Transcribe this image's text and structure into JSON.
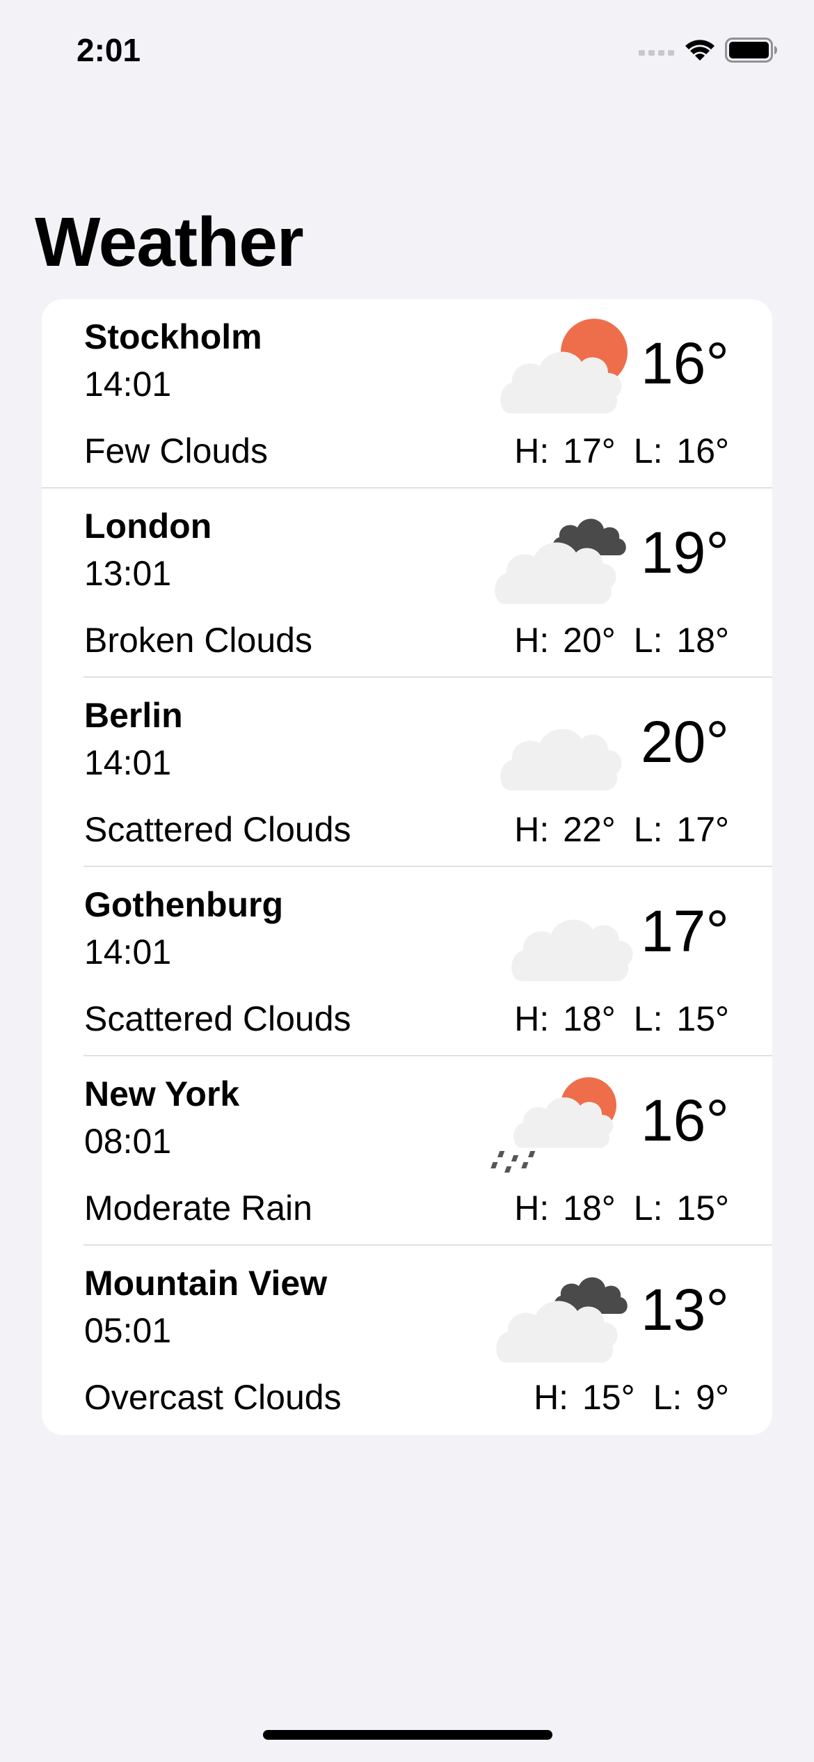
{
  "status_bar": {
    "time": "2:01",
    "icons": [
      "cellular-signal-icon",
      "wifi-icon",
      "battery-icon"
    ]
  },
  "title": "Weather",
  "colors": {
    "background": "#f2f2f7",
    "card": "#ffffff",
    "sun": "#ee6e4b",
    "cloud_light": "#f0f0f0",
    "cloud_dark": "#4a4a4a"
  },
  "cities": [
    {
      "name": "Stockholm",
      "time": "14:01",
      "condition": "Few Clouds",
      "temp": "16°",
      "high": "H: 17°",
      "low": "L: 16°",
      "icon": "few-clouds-icon"
    },
    {
      "name": "London",
      "time": "13:01",
      "condition": "Broken Clouds",
      "temp": "19°",
      "high": "H: 20°",
      "low": "L: 18°",
      "icon": "broken-clouds-icon"
    },
    {
      "name": "Berlin",
      "time": "14:01",
      "condition": "Scattered Clouds",
      "temp": "20°",
      "high": "H: 22°",
      "low": "L: 17°",
      "icon": "scattered-clouds-icon"
    },
    {
      "name": "Gothenburg",
      "time": "14:01",
      "condition": "Scattered Clouds",
      "temp": "17°",
      "high": "H: 18°",
      "low": "L: 15°",
      "icon": "scattered-clouds-icon"
    },
    {
      "name": "New York",
      "time": "08:01",
      "condition": "Moderate Rain",
      "temp": "16°",
      "high": "H: 18°",
      "low": "L: 15°",
      "icon": "moderate-rain-icon"
    },
    {
      "name": "Mountain View",
      "time": "05:01",
      "condition": "Overcast Clouds",
      "temp": "13°",
      "high": "H: 15°",
      "low": "L: 9°",
      "icon": "overcast-clouds-icon"
    }
  ]
}
